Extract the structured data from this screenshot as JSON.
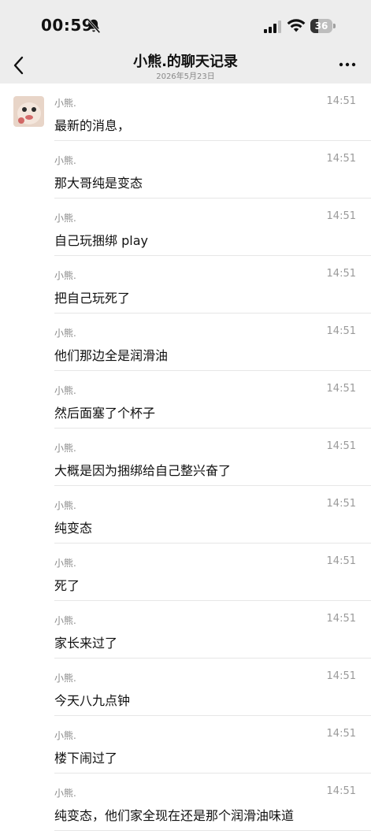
{
  "status_bar": {
    "time": "00:59",
    "battery_level": "36",
    "battery_fraction": 0.36
  },
  "header": {
    "title": "小熊.的聊天记录",
    "date": "2026年5月23日"
  },
  "messages": [
    {
      "sender": "小熊.",
      "time": "14:51",
      "text": "最新的消息，"
    },
    {
      "sender": "小熊.",
      "time": "14:51",
      "text": "那大哥纯是变态"
    },
    {
      "sender": "小熊.",
      "time": "14:51",
      "text": "自己玩捆绑 play"
    },
    {
      "sender": "小熊.",
      "time": "14:51",
      "text": "把自己玩死了"
    },
    {
      "sender": "小熊.",
      "time": "14:51",
      "text": "他们那边全是润滑油"
    },
    {
      "sender": "小熊.",
      "time": "14:51",
      "text": "然后面塞了个杯子"
    },
    {
      "sender": "小熊.",
      "time": "14:51",
      "text": "大概是因为捆绑给自己整兴奋了"
    },
    {
      "sender": "小熊.",
      "time": "14:51",
      "text": "纯变态"
    },
    {
      "sender": "小熊.",
      "time": "14:51",
      "text": "死了"
    },
    {
      "sender": "小熊.",
      "time": "14:51",
      "text": "家长来过了"
    },
    {
      "sender": "小熊.",
      "time": "14:51",
      "text": "今天八九点钟"
    },
    {
      "sender": "小熊.",
      "time": "14:51",
      "text": "楼下闹过了"
    },
    {
      "sender": "小熊.",
      "time": "14:51",
      "text": "纯变态，他们家全现在还是那个润滑油味道"
    }
  ]
}
